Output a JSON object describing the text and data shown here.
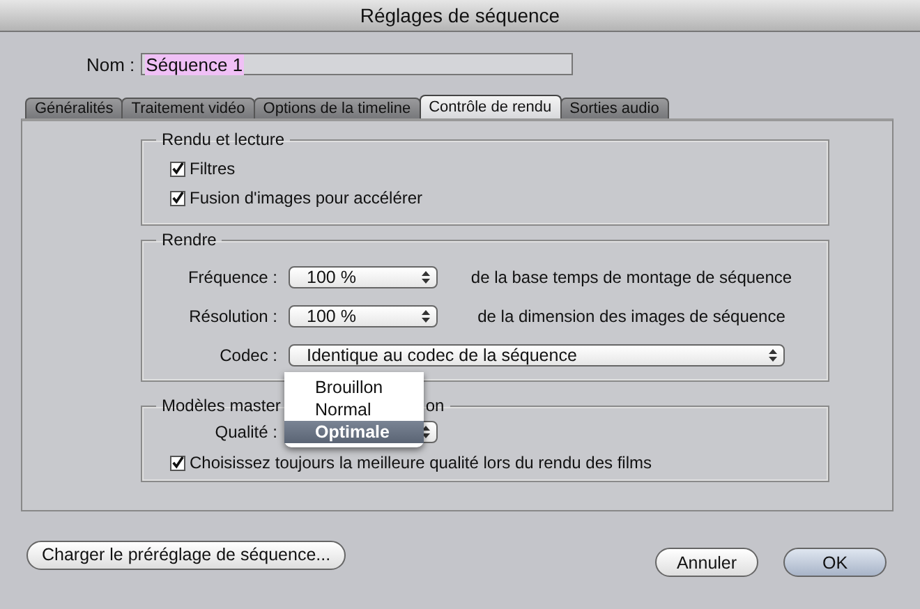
{
  "window": {
    "title": "Réglages de séquence"
  },
  "name_field": {
    "label": "Nom :",
    "value": "Séquence 1"
  },
  "tabs": [
    {
      "label": "Généralités",
      "selected": false
    },
    {
      "label": "Traitement vidéo",
      "selected": false
    },
    {
      "label": "Options de la timeline",
      "selected": false
    },
    {
      "label": "Contrôle de rendu",
      "selected": true
    },
    {
      "label": "Sorties audio",
      "selected": false
    }
  ],
  "render_playback": {
    "title": "Rendu et lecture",
    "checkboxes": [
      {
        "label": "Filtres",
        "checked": true
      },
      {
        "label": "Fusion d'images pour accélérer",
        "checked": true
      }
    ]
  },
  "render": {
    "title": "Rendre",
    "rows": [
      {
        "label": "Fréquence :",
        "value": "100 %",
        "description": "de la base temps de montage de séquence"
      },
      {
        "label": "Résolution :",
        "value": "100 %",
        "description": "de la dimension des images de séquence"
      }
    ],
    "codec": {
      "label": "Codec :",
      "value": "Identique au codec de la séquence"
    }
  },
  "master": {
    "title_parts": [
      "Modèles master",
      "on"
    ],
    "quality_label": "Qualité :",
    "menu": [
      {
        "label": "Brouillon",
        "selected": false
      },
      {
        "label": "Normal",
        "selected": false
      },
      {
        "label": "Optimale",
        "selected": true
      }
    ],
    "checkbox": {
      "label": "Choisissez toujours la meilleure qualité lors du rendu des films",
      "checked": true
    }
  },
  "buttons": [
    {
      "label": "Charger le préréglage de séquence...",
      "default": false
    },
    {
      "label": "Annuler",
      "default": false
    },
    {
      "label": "OK",
      "default": true
    }
  ]
}
